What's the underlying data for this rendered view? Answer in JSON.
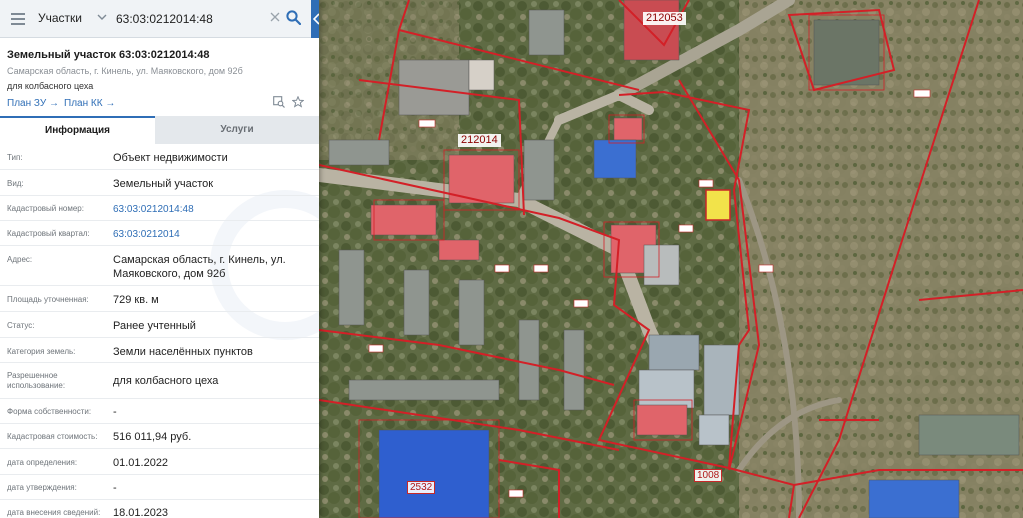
{
  "search": {
    "type_label": "Участки",
    "query": "63:03:0212014:48"
  },
  "object": {
    "title": "Земельный участок 63:03:0212014:48",
    "address": "Самарская область, г. Кинель, ул. Маяковского, дом 92б",
    "purpose": "для колбасного цеха",
    "link_plan_zu": "План ЗУ →",
    "link_plan_kk": "План КК →"
  },
  "tabs": [
    {
      "label": "Информация",
      "active": true
    },
    {
      "label": "Услуги",
      "active": false
    }
  ],
  "fields": [
    {
      "label": "Тип:",
      "value": "Объект недвижимости"
    },
    {
      "label": "Вид:",
      "value": "Земельный участок"
    },
    {
      "label": "Кадастровый номер:",
      "value": "63:03:0212014:48",
      "link": true
    },
    {
      "label": "Кадастровый квартал:",
      "value": "63:03:0212014",
      "link": true
    },
    {
      "label": "Адрес:",
      "value": "Самарская область, г. Кинель, ул. Маяковского, дом 92б"
    },
    {
      "label": "Площадь уточненная:",
      "value": "729 кв. м"
    },
    {
      "label": "Статус:",
      "value": "Ранее учтенный"
    },
    {
      "label": "Категория земель:",
      "value": "Земли населённых пунктов"
    },
    {
      "label": "Разрешенное использование:",
      "value": "для колбасного цеха"
    },
    {
      "label": "Форма собственности:",
      "value": "-"
    },
    {
      "label": "Кадастровая стоимость:",
      "value": "516 011,94 руб."
    },
    {
      "label": "дата определения:",
      "value": "01.01.2022"
    },
    {
      "label": "дата утверждения:",
      "value": "-"
    },
    {
      "label": "дата внесения сведений:",
      "value": "18.01.2023"
    }
  ],
  "map": {
    "quarter_labels": [
      "212014",
      "212053"
    ],
    "parcel_labels": [
      "1008",
      "2532"
    ]
  },
  "colors": {
    "accent": "#2f6eb6",
    "boundary": "#d32027",
    "selected_parcel": "#f2e34a"
  },
  "icons": {
    "menu": "hamburger-icon",
    "dropdown": "chevron-down-icon",
    "clear": "close-icon",
    "search": "magnifier-icon",
    "collapse": "chevron-left-icon",
    "zoom_to": "zoom-to-object-icon",
    "favorite": "star-icon"
  }
}
